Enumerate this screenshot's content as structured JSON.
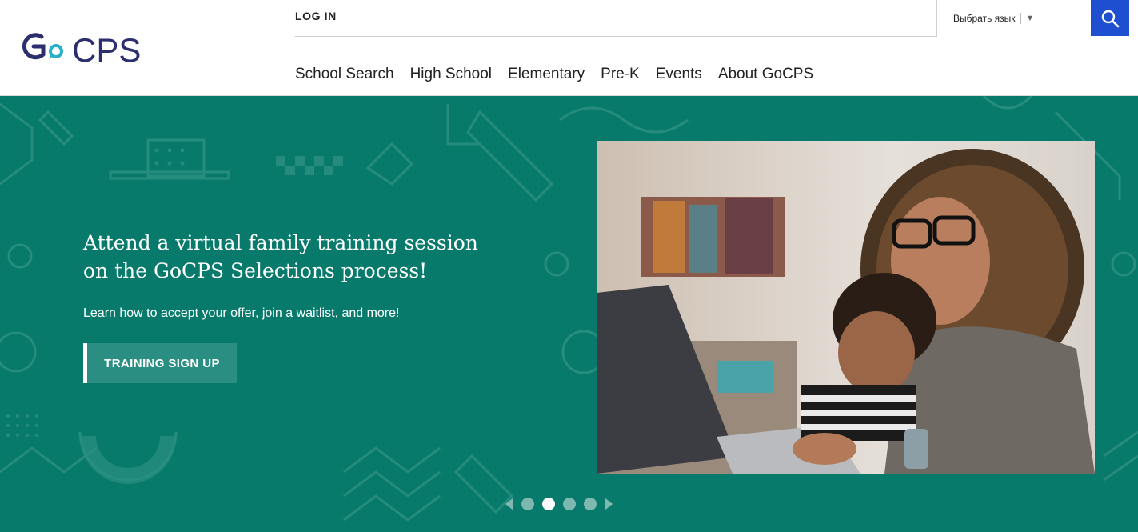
{
  "brand": {
    "logo_go": "Go",
    "logo_cps": "CPS",
    "navy": "#2b2f6e",
    "teal": "#2ab0c8"
  },
  "header": {
    "login": "LOG IN",
    "language": "Выбрать язык",
    "language_arrow": "▼",
    "search_icon": "search-icon"
  },
  "nav": {
    "items": [
      {
        "label": "School Search"
      },
      {
        "label": "High School"
      },
      {
        "label": "Elementary"
      },
      {
        "label": "Pre-K"
      },
      {
        "label": "Events"
      },
      {
        "label": "About GoCPS"
      }
    ]
  },
  "hero": {
    "headline": "Attend a virtual family training session on the GoCPS Selections process!",
    "subtext": "Learn how to accept your offer, join a waitlist, and more!",
    "cta": "TRAINING SIGN UP",
    "background_color": "#087a6c",
    "slides_total": 4,
    "slide_active": 2
  }
}
